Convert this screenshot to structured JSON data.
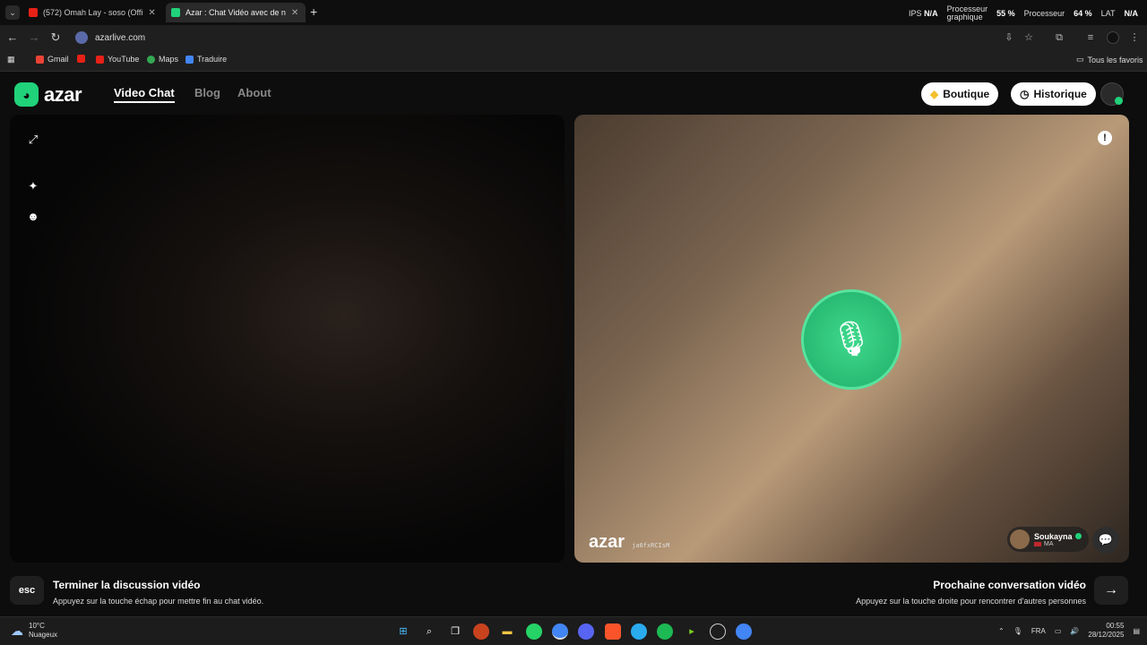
{
  "browser": {
    "tabs": [
      {
        "title": "(572) Omah Lay - soso (Offi",
        "favicon_color": "#e62117"
      },
      {
        "title": "Azar : Chat Vidéo avec de n",
        "favicon_color": "#20d27a"
      }
    ],
    "new_tab_label": "+",
    "hud": {
      "ips_label": "IPS",
      "ips_value": "N/A",
      "gpu_label_1": "Processeur",
      "gpu_label_2": "graphique",
      "gpu_value": "55 %",
      "cpu_label": "Processeur",
      "cpu_value": "64 %",
      "lat_label": "LAT",
      "lat_value": "N/A"
    },
    "url": "azarlive.com",
    "bookmarks": [
      {
        "label": "Gmail",
        "color": "#ea4335"
      },
      {
        "label": "",
        "color": "#e62117"
      },
      {
        "label": "YouTube",
        "color": "#e62117"
      },
      {
        "label": "Maps",
        "color": "#34a853"
      },
      {
        "label": "Traduire",
        "color": "#4285f4"
      }
    ],
    "all_bookmarks_label": "Tous les favoris"
  },
  "site": {
    "logo_text": "azar",
    "nav": [
      "Video Chat",
      "Blog",
      "About"
    ],
    "shop_label": "Boutique",
    "history_label": "Historique",
    "accent": "#20d27a"
  },
  "call": {
    "watermark": "azar",
    "watermark_id": "ja6fxRCIsM",
    "partner_name": "Soukayna",
    "partner_country": "MA"
  },
  "footer": {
    "esc_key": "esc",
    "end_title": "Terminer la discussion vidéo",
    "end_sub": "Appuyez sur la touche échap pour mettre fin au chat vidéo.",
    "next_title": "Prochaine conversation vidéo",
    "next_sub": "Appuyez sur la touche droite pour rencontrer d'autres personnes"
  },
  "taskbar": {
    "weather_temp": "10°C",
    "weather_desc": "Nuageux",
    "lang": "FRA",
    "time": "00:55",
    "date": "28/12/2025"
  }
}
